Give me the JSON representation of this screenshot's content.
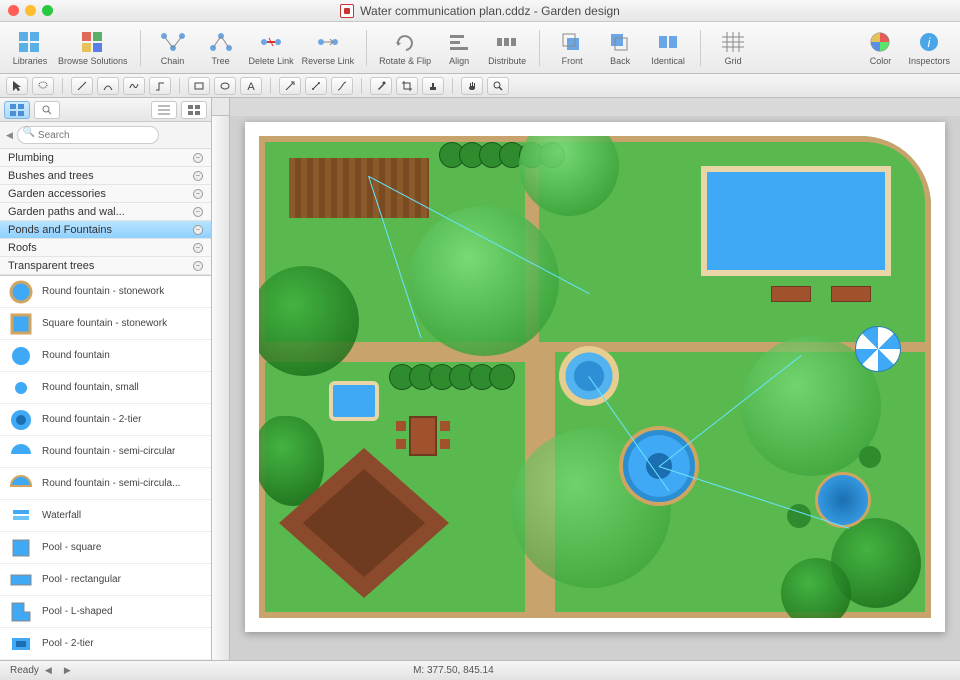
{
  "window": {
    "title": "Water communication plan.cddz - Garden design"
  },
  "toolbar": {
    "libraries": "Libraries",
    "browse_solutions": "Browse Solutions",
    "chain": "Chain",
    "tree": "Tree",
    "delete_link": "Delete Link",
    "reverse_link": "Reverse Link",
    "rotate_flip": "Rotate & Flip",
    "align": "Align",
    "distribute": "Distribute",
    "front": "Front",
    "back": "Back",
    "identical": "Identical",
    "grid": "Grid",
    "color": "Color",
    "inspectors": "Inspectors"
  },
  "sidebar": {
    "search_placeholder": "Search",
    "categories": [
      {
        "label": "Plumbing"
      },
      {
        "label": "Bushes and trees"
      },
      {
        "label": "Garden accessories"
      },
      {
        "label": "Garden paths and wal..."
      },
      {
        "label": "Ponds and Fountains",
        "selected": true
      },
      {
        "label": "Roofs"
      },
      {
        "label": "Transparent trees"
      }
    ],
    "shapes": [
      {
        "label": "Round fountain - stonework",
        "kind": "round-stone"
      },
      {
        "label": "Square fountain - stonework",
        "kind": "square-stone"
      },
      {
        "label": "Round fountain",
        "kind": "round"
      },
      {
        "label": "Round fountain, small",
        "kind": "round-sm"
      },
      {
        "label": "Round fountain - 2-tier",
        "kind": "round-2t"
      },
      {
        "label": "Round fountain - semi-circular",
        "kind": "semi"
      },
      {
        "label": "Round fountain - semi-circula...",
        "kind": "semi2"
      },
      {
        "label": "Waterfall",
        "kind": "waterfall"
      },
      {
        "label": "Pool - square",
        "kind": "pool-sq"
      },
      {
        "label": "Pool - rectangular",
        "kind": "pool-rect"
      },
      {
        "label": "Pool - L-shaped",
        "kind": "pool-l"
      },
      {
        "label": "Pool - 2-tier",
        "kind": "pool-2t"
      }
    ]
  },
  "status": {
    "ready": "Ready",
    "coords_label": "M:",
    "coords": "377.50, 845.14"
  }
}
